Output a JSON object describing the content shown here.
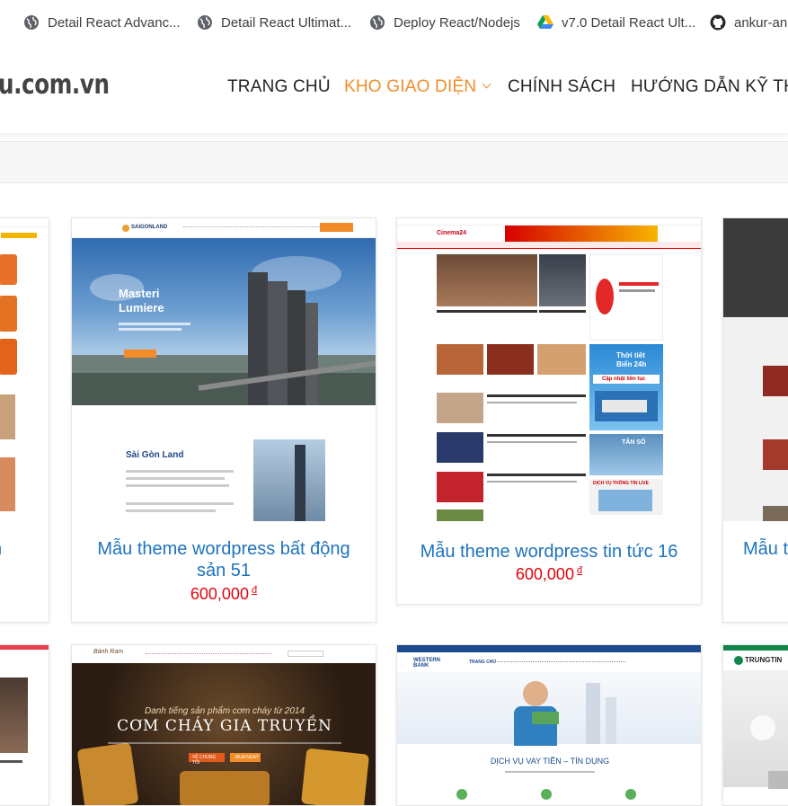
{
  "bookmarks": [
    {
      "label": "Detail React Advanc...",
      "icon": "globe-icon"
    },
    {
      "label": "Detail React Ultimat...",
      "icon": "globe-icon"
    },
    {
      "label": "Deploy React/Nodejs",
      "icon": "globe-icon"
    },
    {
      "label": "v7.0 Detail React Ult...",
      "icon": "google-drive-icon"
    },
    {
      "label": "ankur-an",
      "icon": "github-icon"
    }
  ],
  "header": {
    "logo": "u.com.vn",
    "nav": [
      "TRANG CHỦ",
      "KHO GIAO DIỆN",
      "CHÍNH SÁCH",
      "HƯỚNG DẪN KỸ THU"
    ]
  },
  "colors": {
    "accent": "#f28c28",
    "title": "#1e73be",
    "price": "#e1060d"
  },
  "products": [
    {
      "title_line1": "",
      "title_line2": "n",
      "price": ""
    },
    {
      "title_line1": "Mẫu theme wordpress bất động",
      "title_line2": "sản 51",
      "price": "600,000",
      "currency": "đ",
      "thumb": {
        "brand": "SAIGONLAND",
        "heading1": "Masteri",
        "heading2": "Lumiere",
        "section": "Sài Gòn Land",
        "button": "0977 31 2222"
      }
    },
    {
      "title_line1": "Mẫu theme wordpress tin tức 16",
      "price": "600,000",
      "currency": "đ",
      "thumb": {
        "brand": "Cinema24",
        "weather1": "Thời tiết",
        "weather2": "Biển 24h",
        "weather3": "Cập nhật liên tục",
        "ad": "TÂN SỐ",
        "ad2": "DỊCH VỤ THÔNG TIN LIVE"
      }
    },
    {
      "title_line1": "Mẫu t"
    }
  ],
  "row2": [
    {
      "banner1": "Danh tiếng sản phẩm cơm cháy từ 2014",
      "banner2": "CƠM CHÁY GIA TRUYỀN",
      "btn1": "VỀ CHÚNG TÔI",
      "btn2": "MUA NGAY",
      "logo": "Bánh Ram"
    },
    {
      "logo": "WESTERN BANK",
      "heading": "DỊCH VỤ VAY TIỀN – TÍN DỤNG",
      "nav": "TRANG CHỦ"
    },
    {
      "logo": "TRUNGTIN"
    }
  ]
}
